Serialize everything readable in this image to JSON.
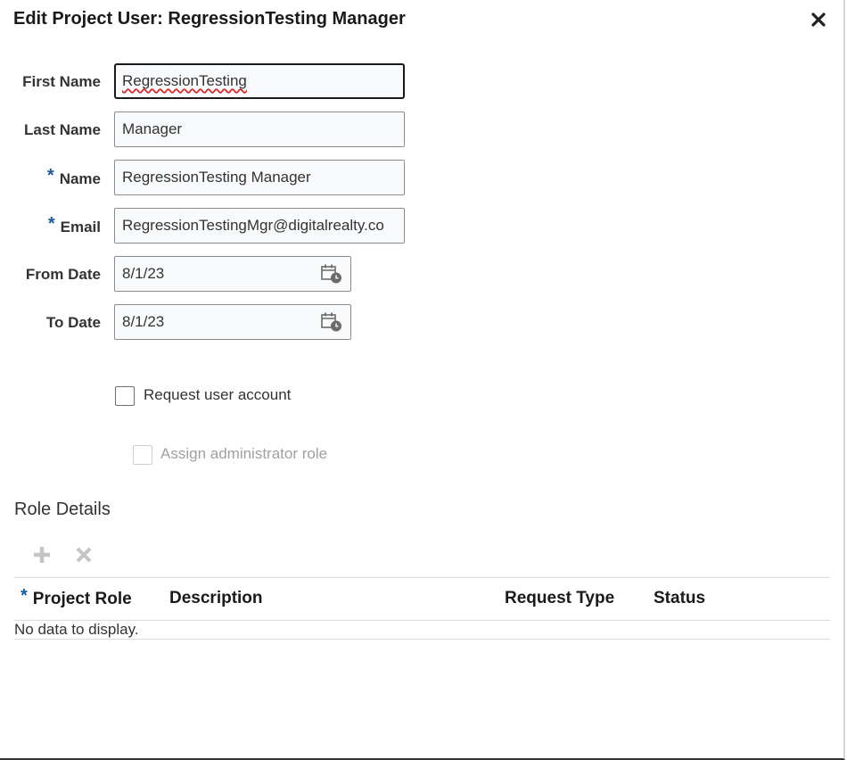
{
  "dialog": {
    "title": "Edit Project User: RegressionTesting Manager",
    "close_icon": "close-icon"
  },
  "form": {
    "first_name": {
      "label": "First Name",
      "value": "RegressionTesting",
      "required": false
    },
    "last_name": {
      "label": "Last Name",
      "value": "Manager",
      "required": false
    },
    "name": {
      "label": "Name",
      "value": "RegressionTesting Manager",
      "required": true
    },
    "email": {
      "label": "Email",
      "value": "RegressionTestingMgr@digitalrealty.co",
      "required": true
    },
    "from_date": {
      "label": "From Date",
      "value": "8/1/23",
      "icon": "calendar-icon"
    },
    "to_date": {
      "label": "To Date",
      "value": "8/1/23",
      "icon": "calendar-icon"
    },
    "required_marker": "*"
  },
  "options": {
    "request_account": {
      "label": "Request user account",
      "checked": false
    },
    "assign_admin": {
      "label": "Assign administrator role",
      "checked": false,
      "disabled": true
    }
  },
  "role_details": {
    "title": "Role Details",
    "toolbar": {
      "add_icon": "plus-icon",
      "delete_icon": "x-icon"
    },
    "columns": [
      "Project Role",
      "Description",
      "Request Type",
      "Status"
    ],
    "empty_text": "No data to display."
  },
  "colors": {
    "required": "#1a5a9e",
    "field_bg": "#f8fafc",
    "disabled_text": "#a0a0a0",
    "spell_underline": "#d22222"
  }
}
